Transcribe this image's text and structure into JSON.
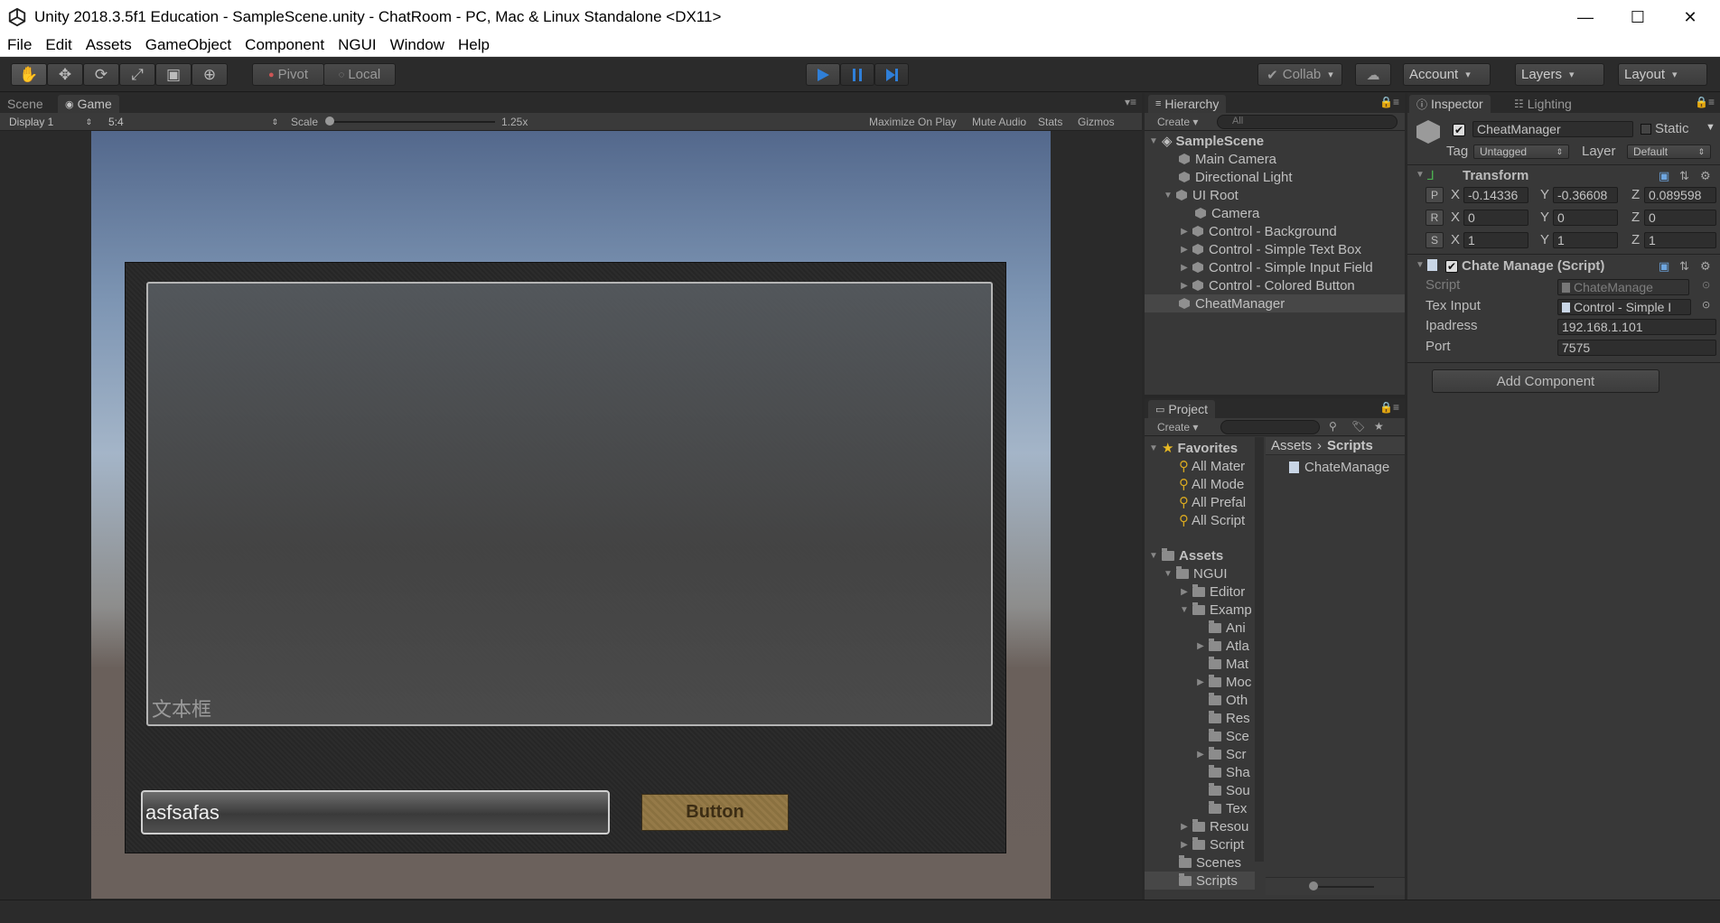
{
  "window": {
    "title": "Unity 2018.3.5f1 Education - SampleScene.unity - ChatRoom - PC, Mac & Linux Standalone <DX11>",
    "minimize": "—",
    "maximize": "☐",
    "close": "✕"
  },
  "menu": [
    "File",
    "Edit",
    "Assets",
    "GameObject",
    "Component",
    "NGUI",
    "Window",
    "Help"
  ],
  "toolbar": {
    "tools": [
      "hand-icon",
      "move-icon",
      "rotate-icon",
      "scale-icon",
      "rect-icon",
      "transform-icon"
    ],
    "pivot": "Pivot",
    "local": "Local",
    "collab": "Collab",
    "account": "Account",
    "layers": "Layers",
    "layout": "Layout"
  },
  "scene_panel": {
    "tabs": [
      "Scene",
      "Game"
    ],
    "display": "Display 1",
    "aspect": "5:4",
    "scale_label": "Scale",
    "scale_value": "1.25x",
    "options": [
      "Maximize On Play",
      "Mute Audio",
      "Stats",
      "Gizmos"
    ]
  },
  "game_view": {
    "textbox_placeholder": "文本框",
    "input_value": "asfsafas",
    "button_label": "Button"
  },
  "hierarchy": {
    "tab": "Hierarchy",
    "create": "Create",
    "search_placeholder": "All",
    "scene": "SampleScene",
    "items": [
      "Main Camera",
      "Directional Light",
      "UI Root",
      "Camera",
      "Control - Background",
      "Control - Simple Text Box",
      "Control - Simple Input Field",
      "Control - Colored Button",
      "CheatManager"
    ]
  },
  "project": {
    "tab": "Project",
    "create": "Create",
    "favorites_label": "Favorites",
    "favorites": [
      "All Mater",
      "All Mode",
      "All Prefal",
      "All Script"
    ],
    "assets_label": "Assets",
    "tree": [
      "NGUI",
      "Editor",
      "Examp",
      "Ani",
      "Atla",
      "Mat",
      "Moc",
      "Oth",
      "Res",
      "Sce",
      "Scr",
      "Sha",
      "Sou",
      "Tex",
      "Resou",
      "Script",
      "Scenes",
      "Scripts"
    ],
    "breadcrumb_root": "Assets",
    "breadcrumb_current": "Scripts",
    "files": [
      "ChateManage"
    ]
  },
  "inspector": {
    "tabs": [
      "Inspector",
      "Lighting"
    ],
    "object_name": "CheatManager",
    "static_label": "Static",
    "tag_label": "Tag",
    "tag_value": "Untagged",
    "layer_label": "Layer",
    "layer_value": "Default",
    "transform": {
      "title": "Transform",
      "position": [
        "-0.14336",
        "-0.36608",
        "0.089598"
      ],
      "rotation": [
        "0",
        "0",
        "0"
      ],
      "scale": [
        "1",
        "1",
        "1"
      ]
    },
    "script_component": {
      "title": "Chate Manage (Script)",
      "script_label": "Script",
      "script_value": "ChateManage",
      "tex_label": "Tex Input",
      "tex_value": "Control - Simple I",
      "ip_label": "Ipadress",
      "ip_value": "192.168.1.101",
      "port_label": "Port",
      "port_value": "7575"
    },
    "add_component": "Add Component"
  },
  "colors": {
    "accent_play": "#2f7fd8",
    "unity_bg": "#383838",
    "button_gold": "#8a7140"
  }
}
